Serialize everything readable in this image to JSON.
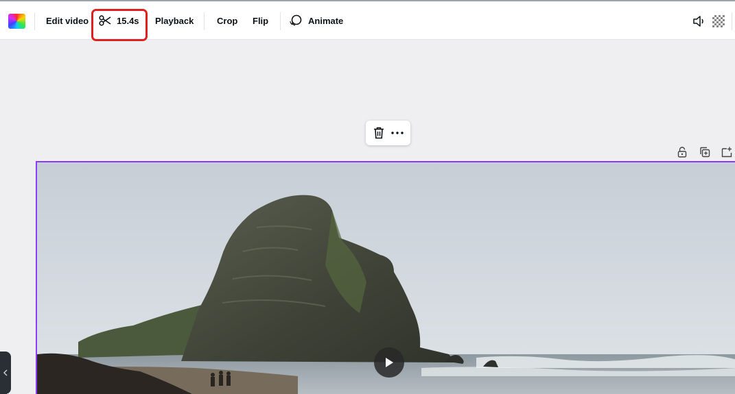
{
  "toolbar": {
    "edit_video_label": "Edit video",
    "trim_duration": "15.4s",
    "playback_label": "Playback",
    "crop_label": "Crop",
    "flip_label": "Flip",
    "animate_label": "Animate"
  },
  "icons": {
    "color": "color-picker-icon",
    "trim": "scissors-icon",
    "animate": "animate-icon",
    "volume": "volume-icon",
    "transparency": "transparency-icon",
    "delete": "trash-icon",
    "more": "more-icon",
    "lock": "lock-icon",
    "duplicate": "duplicate-icon",
    "add_page": "add-page-icon",
    "play": "play-icon",
    "collapse": "chevron-left-icon"
  },
  "colors": {
    "selection_border": "#8b3dff",
    "highlight": "#e02020"
  }
}
